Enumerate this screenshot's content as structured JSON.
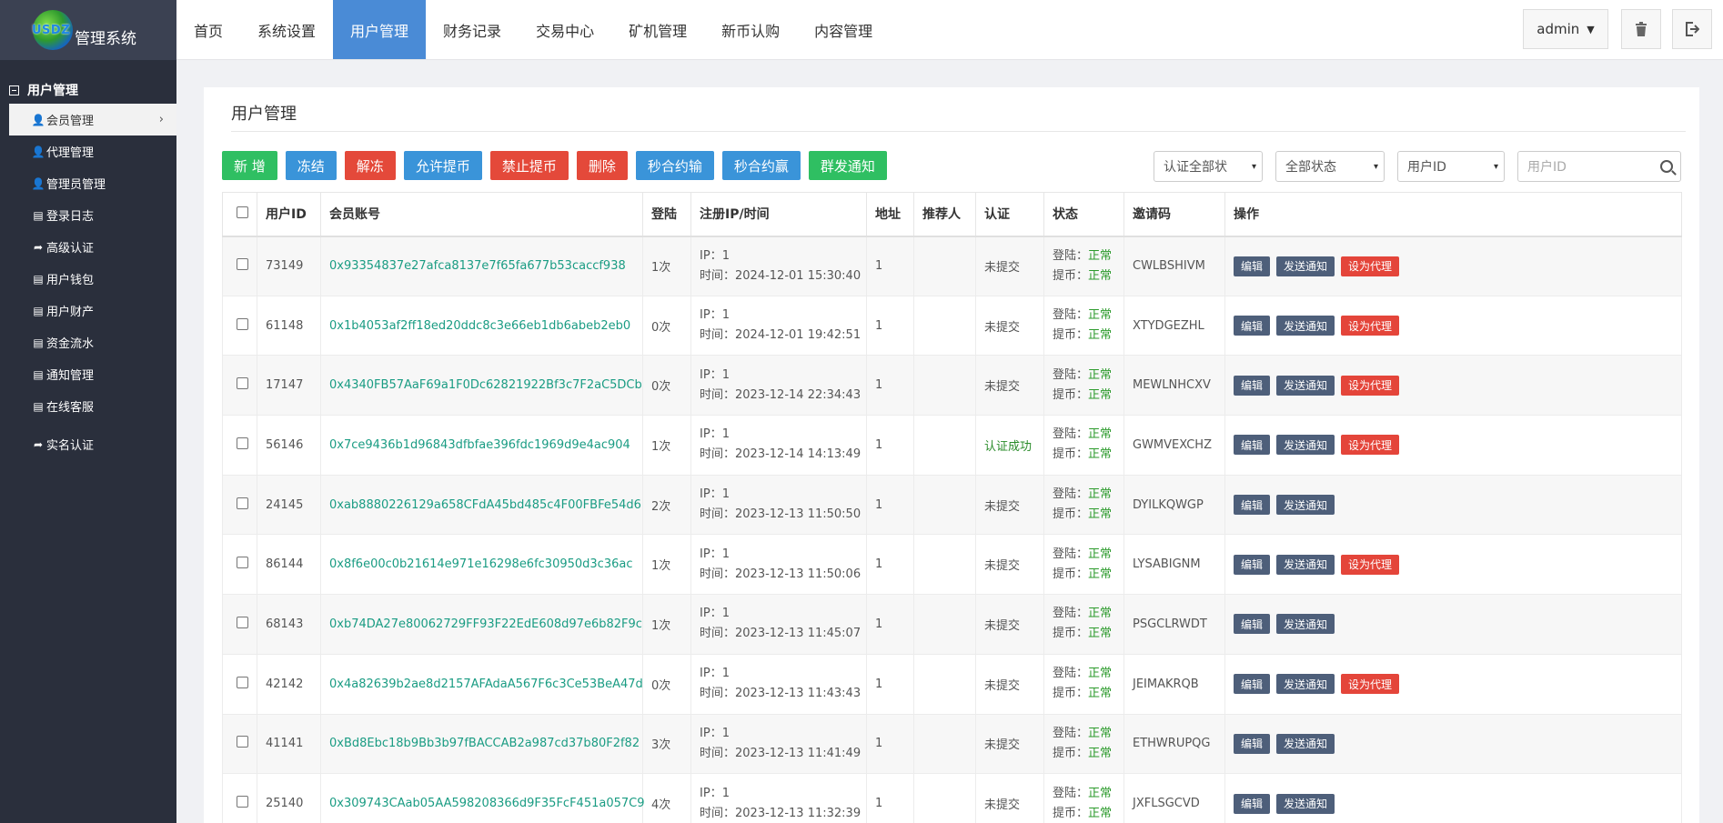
{
  "brand": {
    "logo_text": "USDZ",
    "title": "管理系统"
  },
  "sidebar": {
    "group_label": "用户管理",
    "items": [
      {
        "label": "会员管理",
        "icon": "user-icon"
      },
      {
        "label": "代理管理",
        "icon": "user-icon"
      },
      {
        "label": "管理员管理",
        "icon": "user-icon"
      },
      {
        "label": "登录日志",
        "icon": "list-icon"
      },
      {
        "label": "高级认证",
        "icon": "share-icon"
      },
      {
        "label": "用户钱包",
        "icon": "list-icon"
      },
      {
        "label": "用户财产",
        "icon": "list-icon"
      },
      {
        "label": "资金流水",
        "icon": "list-icon"
      },
      {
        "label": "通知管理",
        "icon": "list-icon"
      },
      {
        "label": "在线客服",
        "icon": "list-icon"
      },
      {
        "label": "实名认证",
        "icon": "share-icon"
      }
    ]
  },
  "topnav": {
    "items": [
      "首页",
      "系统设置",
      "用户管理",
      "财务记录",
      "交易中心",
      "矿机管理",
      "新币认购",
      "内容管理"
    ],
    "user": "admin"
  },
  "page": {
    "title": "用户管理"
  },
  "toolbar": {
    "add": "新 增",
    "freeze": "冻结",
    "unfreeze": "解冻",
    "allow_withdraw": "允许提币",
    "forbid_withdraw": "禁止提币",
    "delete": "删除",
    "loss": "秒合约输",
    "win": "秒合约赢",
    "notify": "群发通知"
  },
  "filters": {
    "auth_status": "认证全部状",
    "all_status": "全部状态",
    "field": "用户ID",
    "search_placeholder": "用户ID"
  },
  "table": {
    "headers": [
      "用户ID",
      "会员账号",
      "登陆",
      "注册IP/时间",
      "地址",
      "推荐人",
      "认证",
      "状态",
      "邀请码",
      "操作"
    ],
    "ip_prefix": "IP：",
    "time_prefix": "时间：",
    "login_status_label": "登陆：",
    "withdraw_status_label": "提币：",
    "action_edit": "编辑",
    "action_notify": "发送通知",
    "action_agent": "设为代理",
    "rows": [
      {
        "id": "73149",
        "account": "0x93354837e27afca8137e7f65fa677b53caccf938",
        "logins": "1次",
        "ip": "1",
        "time": "2024-12-01 15:30:40",
        "address": "1",
        "referrer": "",
        "auth": "未提交",
        "login_status": "正常",
        "withdraw_status": "正常",
        "invite": "CWLBSHIVM",
        "agent": true
      },
      {
        "id": "61148",
        "account": "0x1b4053af2ff18ed20ddc8c3e66eb1db6abeb2eb0",
        "logins": "0次",
        "ip": "1",
        "time": "2024-12-01 19:42:51",
        "address": "1",
        "referrer": "",
        "auth": "未提交",
        "login_status": "正常",
        "withdraw_status": "正常",
        "invite": "XTYDGEZHL",
        "agent": true
      },
      {
        "id": "17147",
        "account": "0x4340FB57AaF69a1F0Dc62821922Bf3c7F2aC5DCb",
        "logins": "0次",
        "ip": "1",
        "time": "2023-12-14 22:34:43",
        "address": "1",
        "referrer": "",
        "auth": "未提交",
        "login_status": "正常",
        "withdraw_status": "正常",
        "invite": "MEWLNHCXV",
        "agent": true
      },
      {
        "id": "56146",
        "account": "0x7ce9436b1d96843dfbfae396fdc1969d9e4ac904",
        "logins": "1次",
        "ip": "1",
        "time": "2023-12-14 14:13:49",
        "address": "1",
        "referrer": "",
        "auth": "认证成功",
        "login_status": "正常",
        "withdraw_status": "正常",
        "invite": "GWMVEXCHZ",
        "agent": true
      },
      {
        "id": "24145",
        "account": "0xab8880226129a658CFdA45bd485c4F00FBFe54d6",
        "logins": "2次",
        "ip": "1",
        "time": "2023-12-13 11:50:50",
        "address": "1",
        "referrer": "",
        "auth": "未提交",
        "login_status": "正常",
        "withdraw_status": "正常",
        "invite": "DYILKQWGP",
        "agent": false
      },
      {
        "id": "86144",
        "account": "0x8f6e00c0b21614e971e16298e6fc30950d3c36ac",
        "logins": "1次",
        "ip": "1",
        "time": "2023-12-13 11:50:06",
        "address": "1",
        "referrer": "",
        "auth": "未提交",
        "login_status": "正常",
        "withdraw_status": "正常",
        "invite": "LYSABIGNM",
        "agent": true
      },
      {
        "id": "68143",
        "account": "0xb74DA27e80062729FF93F22EdE608d97e6b82F9c",
        "logins": "1次",
        "ip": "1",
        "time": "2023-12-13 11:45:07",
        "address": "1",
        "referrer": "",
        "auth": "未提交",
        "login_status": "正常",
        "withdraw_status": "正常",
        "invite": "PSGCLRWDT",
        "agent": false
      },
      {
        "id": "42142",
        "account": "0x4a82639b2ae8d2157AFAdaA567F6c3Ce53BeA47d",
        "logins": "0次",
        "ip": "1",
        "time": "2023-12-13 11:43:43",
        "address": "1",
        "referrer": "",
        "auth": "未提交",
        "login_status": "正常",
        "withdraw_status": "正常",
        "invite": "JEIMAKRQB",
        "agent": true
      },
      {
        "id": "41141",
        "account": "0xBd8Ebc18b9Bb3b97fBACCAB2a987cd37b80F2f82",
        "logins": "3次",
        "ip": "1",
        "time": "2023-12-13 11:41:49",
        "address": "1",
        "referrer": "",
        "auth": "未提交",
        "login_status": "正常",
        "withdraw_status": "正常",
        "invite": "ETHWRUPQG",
        "agent": false
      },
      {
        "id": "25140",
        "account": "0x309743CAab05AA598208366d9F35FcF451a057C9",
        "logins": "4次",
        "ip": "1",
        "time": "2023-12-13 11:32:39",
        "address": "1",
        "referrer": "",
        "auth": "未提交",
        "login_status": "正常",
        "withdraw_status": "正常",
        "invite": "JXFLSGCVD",
        "agent": false
      }
    ]
  },
  "colors": {
    "accent": "#4a8bd6",
    "sidebar": "#2a2f3c",
    "green": "#2fbf62",
    "blue": "#3a94d9",
    "red": "#e4493a",
    "link": "#1a9c83"
  }
}
